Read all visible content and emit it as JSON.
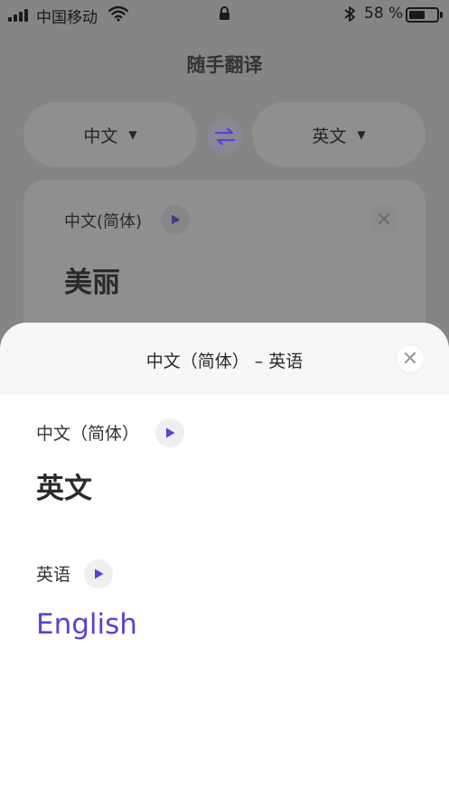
{
  "status_bar": {
    "carrier": "中国移动",
    "battery_text": "58 %",
    "battery_level": 0.58,
    "icons": [
      "signal-icon",
      "wifi-icon",
      "lock-icon",
      "bluetooth-icon",
      "battery-icon"
    ]
  },
  "app": {
    "title": "随手翻译",
    "source_lang": "中文",
    "target_lang": "英文",
    "input_card": {
      "lang_label": "中文(简体)",
      "input_text": "美丽"
    }
  },
  "sheet": {
    "title": "中文（简体） – 英语",
    "source": {
      "lang_label": "中文（简体）",
      "text": "英文"
    },
    "target": {
      "lang_label": "英语",
      "text": "English"
    }
  },
  "colors": {
    "accent": "#5a41d6",
    "overlay": "#858585",
    "sheet_bg": "#ffffff",
    "sheet_header_bg": "#f7f7f7"
  }
}
